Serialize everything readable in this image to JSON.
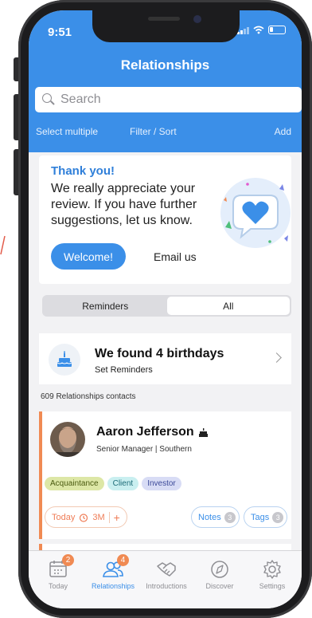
{
  "status_bar": {
    "time": "9:51"
  },
  "nav": {
    "title": "Relationships"
  },
  "search": {
    "placeholder": "Search"
  },
  "toolbar": {
    "select_multiple": "Select multiple",
    "filter_sort": "Filter / Sort",
    "add": "Add"
  },
  "thanks_card": {
    "title": "Thank you!",
    "body": "We really appreciate your review. If you have further suggestions, let us know.",
    "welcome_label": "Welcome!",
    "email_label": "Email us"
  },
  "segment": {
    "options": [
      "Reminders",
      "All"
    ],
    "selected": "All"
  },
  "birthdays": {
    "title": "We found 4 birthdays",
    "subtitle": "Set Reminders"
  },
  "contacts_count": "609 Relationships contacts",
  "contact": {
    "name": "Aaron Jefferson",
    "role": "Senior Manager | Southern",
    "tags": [
      "Acquaintance",
      "Client",
      "Investor"
    ],
    "reminder_today": "Today",
    "reminder_interval": "3M",
    "reminder_add": "+",
    "notes_label": "Notes",
    "notes_count": "3",
    "tags_label": "Tags",
    "tags_count": "3"
  },
  "tabs": [
    {
      "label": "Today",
      "badge": "2",
      "icon": "calendar-icon"
    },
    {
      "label": "Relationships",
      "badge": "4",
      "icon": "people-icon"
    },
    {
      "label": "Introductions",
      "badge": "",
      "icon": "handshake-icon"
    },
    {
      "label": "Discover",
      "badge": "",
      "icon": "compass-icon"
    },
    {
      "label": "Settings",
      "badge": "",
      "icon": "gear-icon"
    }
  ],
  "colors": {
    "primary": "#3b8fe8",
    "accent": "#f08a53"
  }
}
